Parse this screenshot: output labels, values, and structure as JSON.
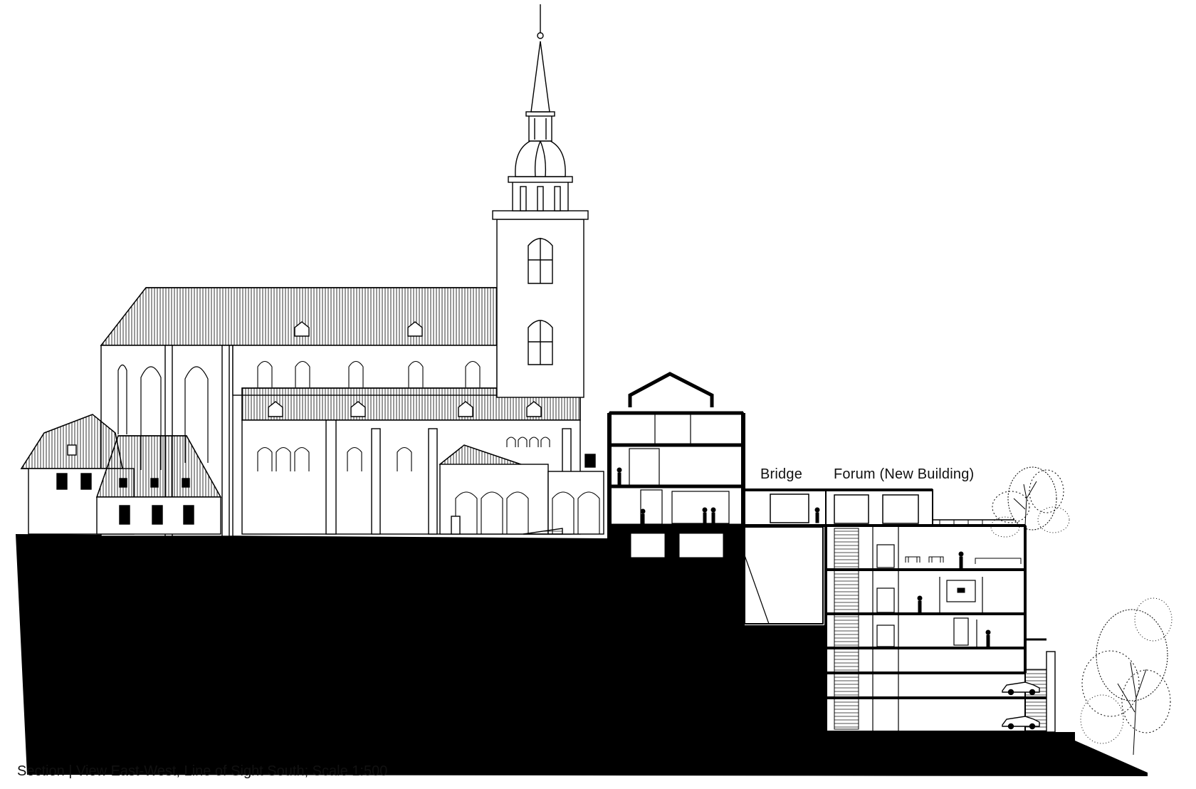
{
  "labels": {
    "bridge": "Bridge",
    "forum": "Forum (New Building)"
  },
  "caption": "Section | View East-West, Line of Sight South; Scale 1:500",
  "colors": {
    "ink": "#000000",
    "paper": "#ffffff"
  }
}
